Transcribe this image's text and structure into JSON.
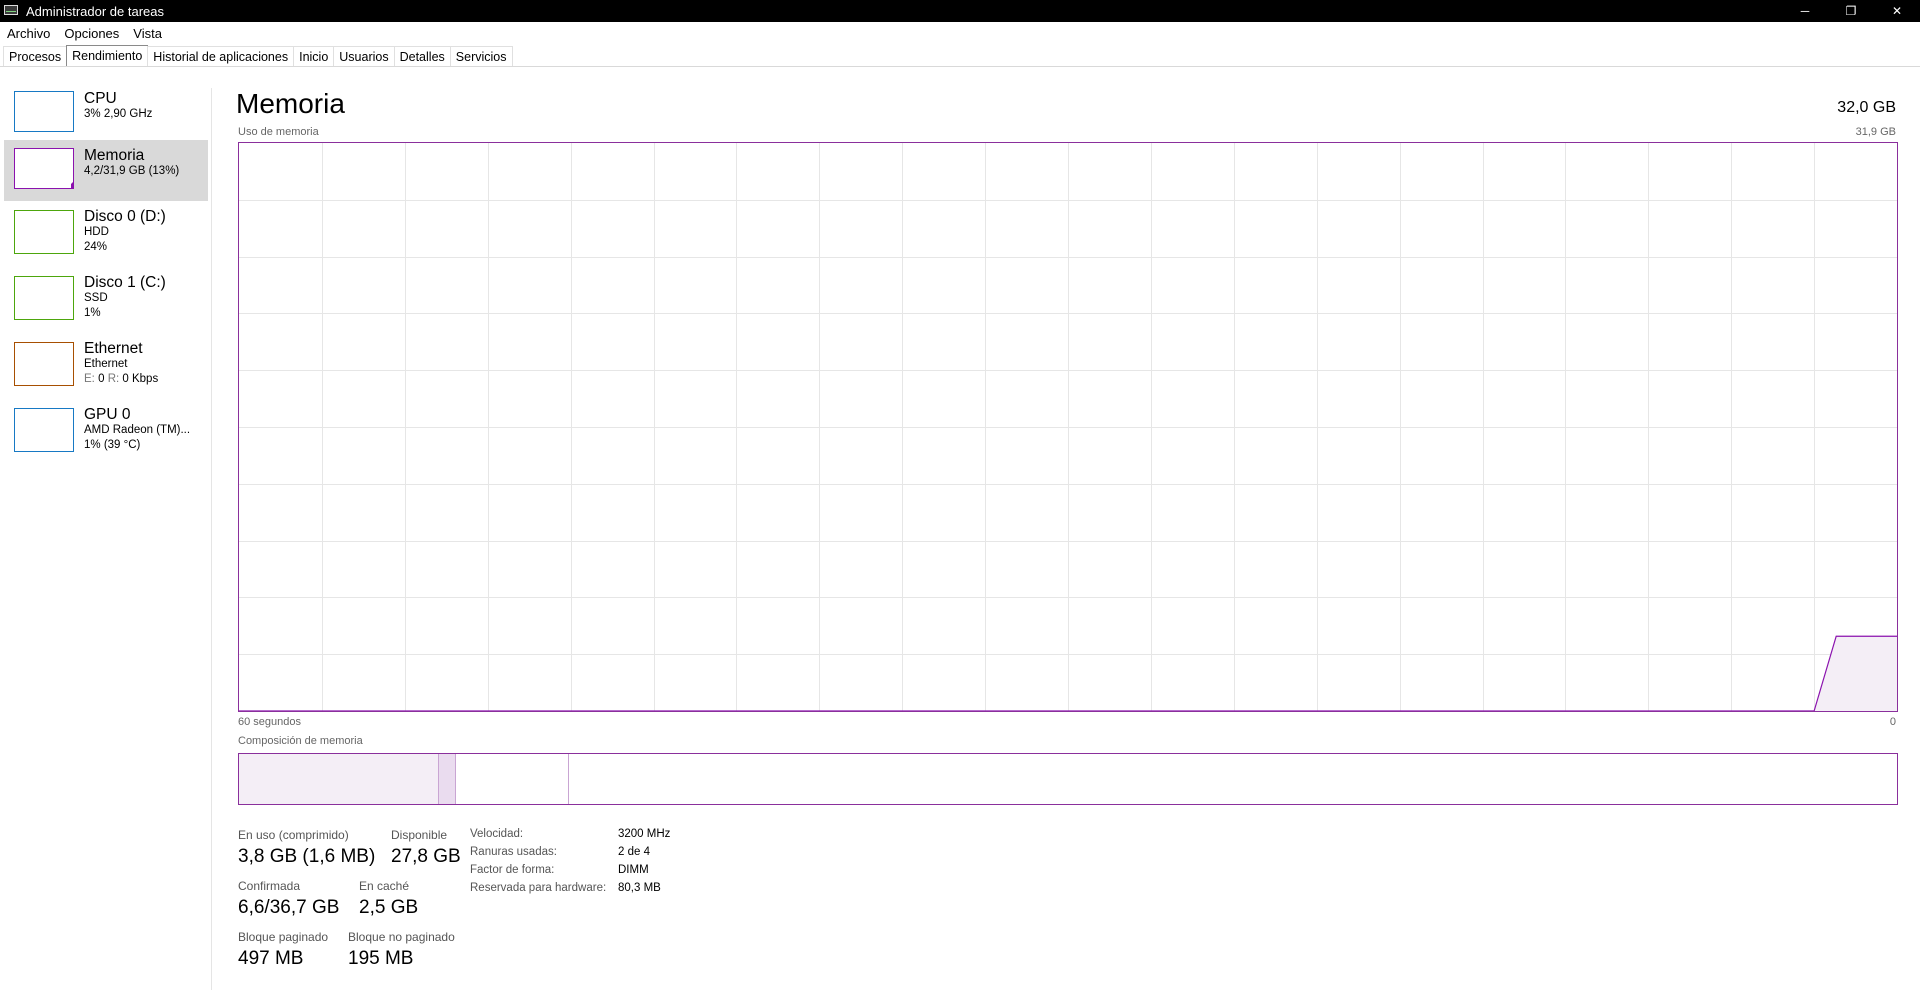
{
  "window": {
    "title": "Administrador de tareas",
    "controls": [
      "─",
      "❐",
      "✕"
    ]
  },
  "menu": [
    "Archivo",
    "Opciones",
    "Vista"
  ],
  "tabs": [
    "Procesos",
    "Rendimiento",
    "Historial de aplicaciones",
    "Inicio",
    "Usuarios",
    "Detalles",
    "Servicios"
  ],
  "active_tab": "Rendimiento",
  "sidebar": {
    "items": [
      {
        "name": "CPU",
        "line2": "3% 2,90 GHz",
        "line3": "",
        "color": "#1779c4"
      },
      {
        "name": "Memoria",
        "line2": "4,2/31,9 GB (13%)",
        "line3": "",
        "color": "#8b12ae"
      },
      {
        "name": "Disco 0 (D:)",
        "line2": "HDD",
        "line3": "24%",
        "color": "#4da60c"
      },
      {
        "name": "Disco 1 (C:)",
        "line2": "SSD",
        "line3": "1%",
        "color": "#4da60c"
      },
      {
        "name": "Ethernet",
        "line2": "Ethernet",
        "line3_prefix_e": "E:",
        "line3_e": "0",
        "line3_prefix_r": "R:",
        "line3_r": "0 Kbps",
        "color": "#a74f01"
      },
      {
        "name": "GPU 0",
        "line2": "AMD Radeon (TM)...",
        "line3": "1% (39 °C)",
        "color": "#1779c4"
      }
    ],
    "selected": "Memoria"
  },
  "main": {
    "title": "Memoria",
    "total": "32,0 GB",
    "usage_label": "Uso de memoria",
    "usage_max": "31,9 GB",
    "time_left": "60 segundos",
    "time_right": "0",
    "composition_label": "Composición de memoria",
    "accent": "#8b12ae"
  },
  "stats": {
    "in_use_label": "En uso (comprimido)",
    "in_use_value": "3,8 GB (1,6 MB)",
    "available_label": "Disponible",
    "available_value": "27,8 GB",
    "committed_label": "Confirmada",
    "committed_value": "6,6/36,7 GB",
    "cached_label": "En caché",
    "cached_value": "2,5 GB",
    "paged_label": "Bloque paginado",
    "paged_value": "497 MB",
    "nonpaged_label": "Bloque no paginado",
    "nonpaged_value": "195 MB"
  },
  "specs": [
    {
      "key": "Velocidad:",
      "value": "3200 MHz"
    },
    {
      "key": "Ranuras usadas:",
      "value": "2 de 4"
    },
    {
      "key": "Factor de forma:",
      "value": "DIMM"
    },
    {
      "key": "Reservada para hardware:",
      "value": "80,3 MB"
    }
  ],
  "chart_data": {
    "type": "area",
    "title": "Uso de memoria",
    "xlabel": "",
    "ylabel": "",
    "x_label_left": "60 segundos",
    "x_label_right": "0",
    "ylim": [
      0,
      31.9
    ],
    "grid": true,
    "series": [
      {
        "x": [
          60,
          3,
          2.2,
          0
        ],
        "values": [
          0,
          0,
          4.2,
          4.2
        ]
      }
    ]
  }
}
